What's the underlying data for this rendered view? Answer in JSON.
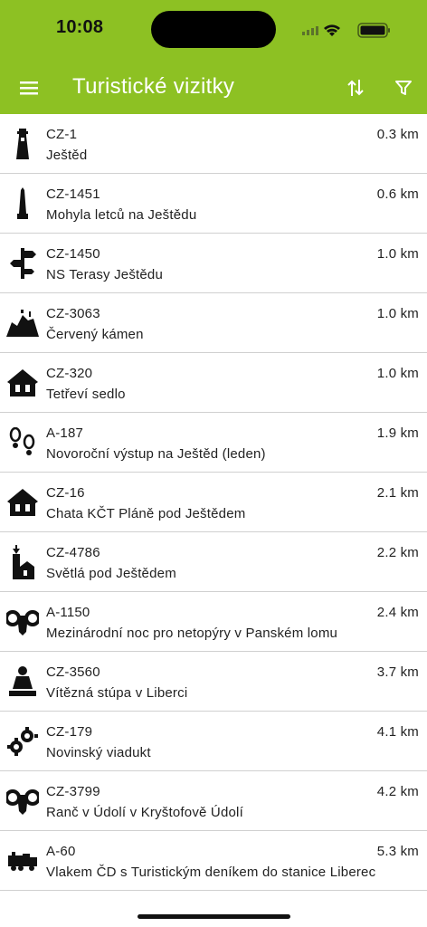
{
  "status_bar": {
    "time": "10:08"
  },
  "toolbar": {
    "title": "Turistické vizitky"
  },
  "items": [
    {
      "code": "CZ-1",
      "name": "Ještěd",
      "distance": "0.3 km",
      "icon": "lookout-tower-icon"
    },
    {
      "code": "CZ-1451",
      "name": "Mohyla letců na Ještědu",
      "distance": "0.6 km",
      "icon": "monument-icon"
    },
    {
      "code": "CZ-1450",
      "name": "NS Terasy Ještědu",
      "distance": "1.0 km",
      "icon": "signpost-icon"
    },
    {
      "code": "CZ-3063",
      "name": "Červený kámen",
      "distance": "1.0 km",
      "icon": "rock-viewpoint-icon"
    },
    {
      "code": "CZ-320",
      "name": "Tetřeví sedlo",
      "distance": "1.0 km",
      "icon": "chalet-icon"
    },
    {
      "code": "A-187",
      "name": "Novoroční výstup na Ještěd (leden)",
      "distance": "1.9 km",
      "icon": "footprints-icon"
    },
    {
      "code": "CZ-16",
      "name": "Chata KČT Pláně pod Ještědem",
      "distance": "2.1 km",
      "icon": "chalet-icon"
    },
    {
      "code": "CZ-4786",
      "name": "Světlá pod Ještědem",
      "distance": "2.2 km",
      "icon": "village-church-icon"
    },
    {
      "code": "A-1150",
      "name": "Mezinárodní noc pro netopýry v Panském lomu",
      "distance": "2.4 km",
      "icon": "ram-head-icon"
    },
    {
      "code": "CZ-3560",
      "name": "Vítězná stúpa v Liberci",
      "distance": "3.7 km",
      "icon": "buddha-icon"
    },
    {
      "code": "CZ-179",
      "name": "Novinský viadukt",
      "distance": "4.1 km",
      "icon": "gears-icon"
    },
    {
      "code": "CZ-3799",
      "name": "Ranč v Údolí v Kryštofově Údolí",
      "distance": "4.2 km",
      "icon": "ram-head-icon"
    },
    {
      "code": "A-60",
      "name": "Vlakem ČD s Turistickým deníkem do stanice Liberec",
      "distance": "5.3 km",
      "icon": "train-icon"
    }
  ]
}
